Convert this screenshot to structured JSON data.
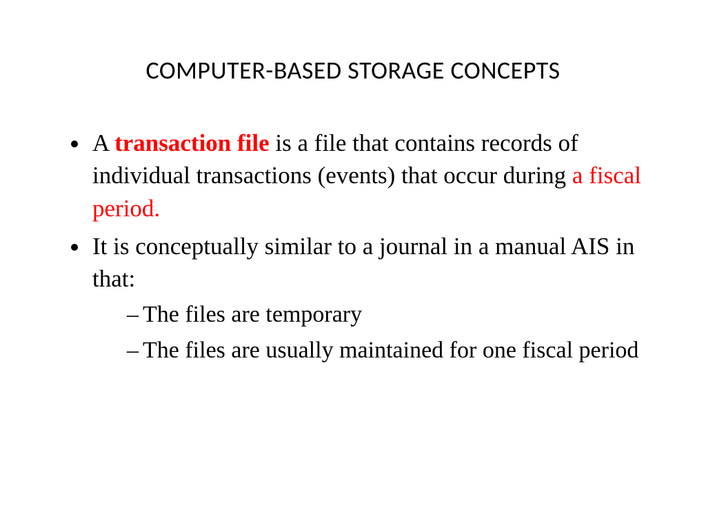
{
  "title": "COMPUTER-BASED STORAGE CONCEPTS",
  "bullets": [
    {
      "parts": [
        {
          "text": "A ",
          "class": ""
        },
        {
          "text": "transaction file",
          "class": "red bold"
        },
        {
          "text": " is a file that contains records of individual transactions (events) that occur during ",
          "class": ""
        },
        {
          "text": "a fiscal period.",
          "class": "red"
        }
      ]
    },
    {
      "parts": [
        {
          "text": "It is conceptually similar to a journal in a manual AIS in that:",
          "class": ""
        }
      ],
      "sub": [
        "The files are temporary",
        "The files are usually maintained for one fiscal period"
      ]
    }
  ]
}
